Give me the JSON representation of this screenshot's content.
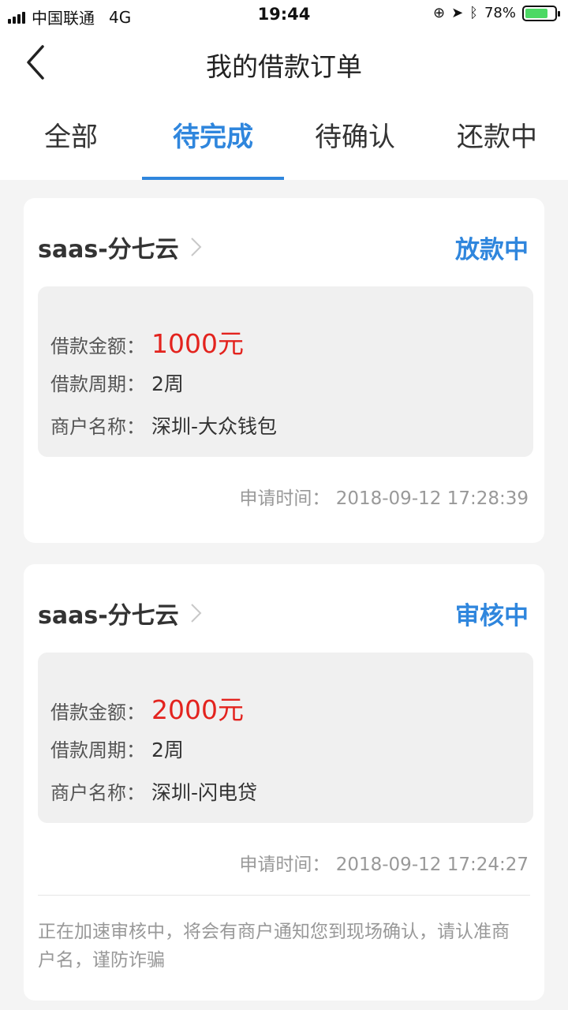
{
  "status_bar": {
    "carrier": "中国联通",
    "network": "4G",
    "time": "19:44",
    "battery_percent": "78%",
    "battery_level": 0.78,
    "battery_color": "#4cd964"
  },
  "nav": {
    "back_icon": "chevron-left-icon",
    "title": "我的借款订单"
  },
  "tabs": [
    {
      "label": "全部",
      "active": false
    },
    {
      "label": "待完成",
      "active": true
    },
    {
      "label": "待确认",
      "active": false
    },
    {
      "label": "还款中",
      "active": false
    }
  ],
  "colors": {
    "accent": "#2f86dd",
    "amount": "#e3231e",
    "muted": "#999999"
  },
  "orders": [
    {
      "platform": "saas-分七云",
      "status": "放款中",
      "amount_label": "借款金额：",
      "amount": "1000元",
      "period_label": "借款周期：",
      "period": "2周",
      "merchant_label": "商户名称：",
      "merchant": "深圳-大众钱包",
      "apply_time_label": "申请时间：",
      "apply_time": "2018-09-12 17:28:39"
    },
    {
      "platform": "saas-分七云",
      "status": "审核中",
      "amount_label": "借款金额：",
      "amount": "2000元",
      "period_label": "借款周期：",
      "period": "2周",
      "merchant_label": "商户名称：",
      "merchant": "深圳-闪电贷",
      "apply_time_label": "申请时间：",
      "apply_time": "2018-09-12 17:24:27",
      "notice": "正在加速审核中，将会有商户通知您到现场确认，请认准商户名，谨防诈骗"
    }
  ]
}
